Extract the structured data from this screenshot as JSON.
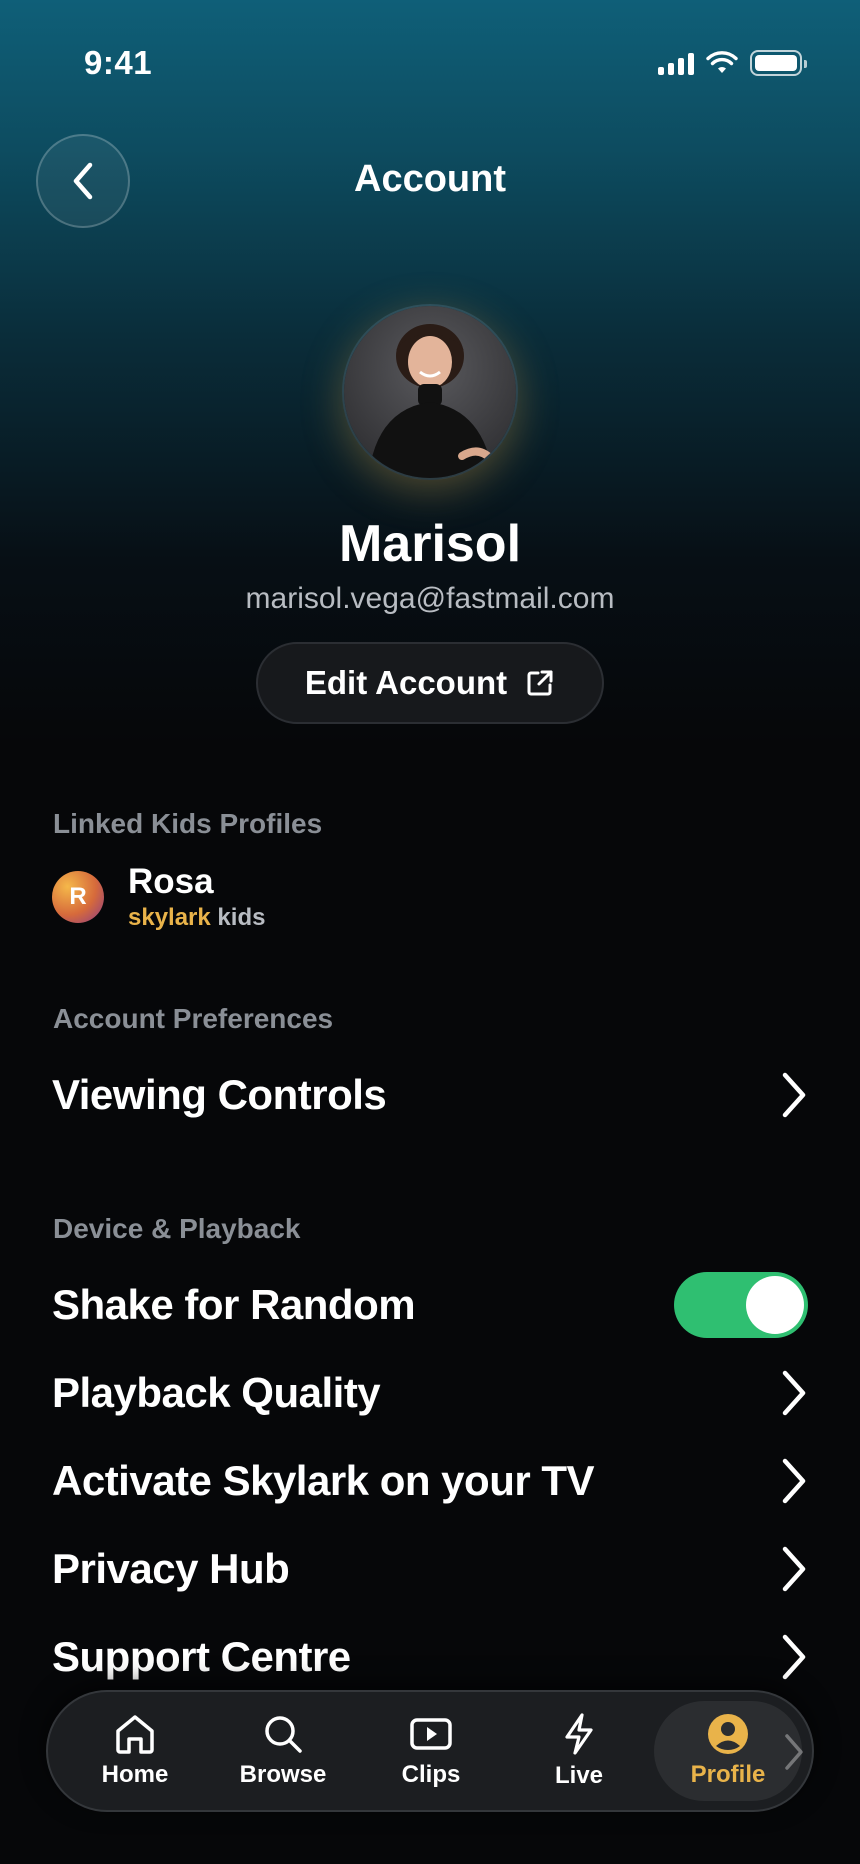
{
  "status_bar": {
    "time": "9:41"
  },
  "header": {
    "title": "Account"
  },
  "profile": {
    "name": "Marisol",
    "email": "marisol.vega@fastmail.com",
    "edit_label": "Edit Account"
  },
  "kids": {
    "section_label": "Linked Kids Profiles",
    "profile": {
      "initial": "R",
      "name": "Rosa",
      "brand_primary": "skylark",
      "brand_secondary": "kids"
    }
  },
  "preferences": {
    "section_label": "Account Preferences",
    "items": [
      {
        "label": "Viewing Controls"
      }
    ]
  },
  "device": {
    "section_label": "Device & Playback",
    "items": [
      {
        "label": "Shake for Random",
        "control": "toggle",
        "on": true
      },
      {
        "label": "Playback Quality",
        "control": "chevron"
      },
      {
        "label": "Activate Skylark on your TV",
        "control": "chevron"
      },
      {
        "label": "Privacy Hub",
        "control": "chevron"
      },
      {
        "label": "Support Centre",
        "control": "chevron"
      }
    ]
  },
  "tabbar": {
    "tabs": [
      {
        "label": "Home",
        "icon": "home-icon"
      },
      {
        "label": "Browse",
        "icon": "search-icon"
      },
      {
        "label": "Clips",
        "icon": "play-icon"
      },
      {
        "label": "Live",
        "icon": "lightning-icon"
      },
      {
        "label": "Profile",
        "icon": "user-icon",
        "active": true
      }
    ]
  },
  "colors": {
    "accent": "#e9b34a",
    "toggle_on": "#2fbf71",
    "background": "#060709"
  }
}
